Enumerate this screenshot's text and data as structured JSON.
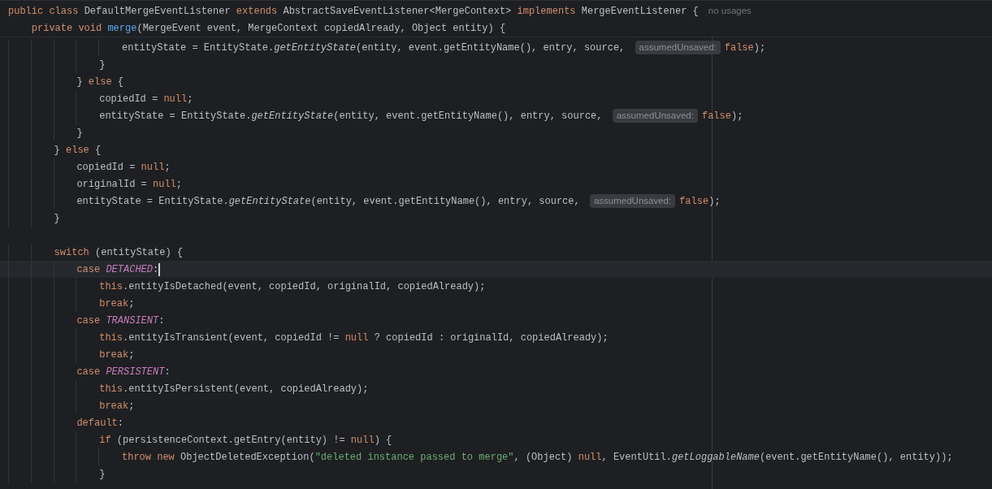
{
  "sticky_lines": [
    {
      "tokens": [
        {
          "kind": "keyword",
          "text": "public class "
        },
        {
          "kind": "plain",
          "text": "DefaultMergeEventListener "
        },
        {
          "kind": "keyword",
          "text": "extends "
        },
        {
          "kind": "plain",
          "text": "AbstractSaveEventListener<MergeContext> "
        },
        {
          "kind": "keyword",
          "text": "implements "
        },
        {
          "kind": "plain",
          "text": "MergeEventListener {"
        },
        {
          "kind": "usages",
          "text": "no usages"
        }
      ]
    },
    {
      "tokens": [
        {
          "kind": "keyword",
          "text": "    private void "
        },
        {
          "kind": "declaration",
          "text": "merge"
        },
        {
          "kind": "plain",
          "text": "(MergeEvent event, MergeContext copiedAlready, Object entity) {"
        }
      ]
    }
  ],
  "lines": [
    {
      "current": false,
      "tokens": [
        {
          "kind": "plain",
          "text": "                    entityState = EntityState."
        },
        {
          "kind": "static_call",
          "text": "getEntityState"
        },
        {
          "kind": "plain",
          "text": "(entity, event.getEntityName(), entry, source, "
        },
        {
          "kind": "hint",
          "text": "assumedUnsaved:"
        },
        {
          "kind": "keyword",
          "text": "false"
        },
        {
          "kind": "plain",
          "text": ");"
        }
      ]
    },
    {
      "current": false,
      "tokens": [
        {
          "kind": "plain",
          "text": "                }"
        }
      ]
    },
    {
      "current": false,
      "tokens": [
        {
          "kind": "plain",
          "text": "            } "
        },
        {
          "kind": "keyword",
          "text": "else"
        },
        {
          "kind": "plain",
          "text": " {"
        }
      ]
    },
    {
      "current": false,
      "tokens": [
        {
          "kind": "plain",
          "text": "                copiedId = "
        },
        {
          "kind": "keyword",
          "text": "null"
        },
        {
          "kind": "plain",
          "text": ";"
        }
      ]
    },
    {
      "current": false,
      "tokens": [
        {
          "kind": "plain",
          "text": "                entityState = EntityState."
        },
        {
          "kind": "static_call",
          "text": "getEntityState"
        },
        {
          "kind": "plain",
          "text": "(entity, event.getEntityName(), entry, source, "
        },
        {
          "kind": "hint",
          "text": "assumedUnsaved:"
        },
        {
          "kind": "keyword",
          "text": "false"
        },
        {
          "kind": "plain",
          "text": ");"
        }
      ]
    },
    {
      "current": false,
      "tokens": [
        {
          "kind": "plain",
          "text": "            }"
        }
      ]
    },
    {
      "current": false,
      "tokens": [
        {
          "kind": "plain",
          "text": "        } "
        },
        {
          "kind": "keyword",
          "text": "else"
        },
        {
          "kind": "plain",
          "text": " {"
        }
      ]
    },
    {
      "current": false,
      "tokens": [
        {
          "kind": "plain",
          "text": "            copiedId = "
        },
        {
          "kind": "keyword",
          "text": "null"
        },
        {
          "kind": "plain",
          "text": ";"
        }
      ]
    },
    {
      "current": false,
      "tokens": [
        {
          "kind": "plain",
          "text": "            originalId = "
        },
        {
          "kind": "keyword",
          "text": "null"
        },
        {
          "kind": "plain",
          "text": ";"
        }
      ]
    },
    {
      "current": false,
      "tokens": [
        {
          "kind": "plain",
          "text": "            entityState = EntityState."
        },
        {
          "kind": "static_call",
          "text": "getEntityState"
        },
        {
          "kind": "plain",
          "text": "(entity, event.getEntityName(), entry, source, "
        },
        {
          "kind": "hint",
          "text": "assumedUnsaved:"
        },
        {
          "kind": "keyword",
          "text": "false"
        },
        {
          "kind": "plain",
          "text": ");"
        }
      ]
    },
    {
      "current": false,
      "tokens": [
        {
          "kind": "plain",
          "text": "        }"
        }
      ]
    },
    {
      "current": false
    },
    {
      "current": false,
      "tokens": [
        {
          "kind": "keyword",
          "text": "        switch"
        },
        {
          "kind": "plain",
          "text": " (entityState) {"
        }
      ]
    },
    {
      "current": true,
      "tokens": [
        {
          "kind": "keyword",
          "text": "            case "
        },
        {
          "kind": "constant",
          "text": "DETACHED"
        },
        {
          "kind": "plain",
          "text": ":"
        }
      ]
    },
    {
      "current": false,
      "tokens": [
        {
          "kind": "keyword",
          "text": "                this"
        },
        {
          "kind": "plain",
          "text": ".entityIsDetached(event, copiedId, originalId, copiedAlready);"
        }
      ]
    },
    {
      "current": false,
      "tokens": [
        {
          "kind": "keyword",
          "text": "                break"
        },
        {
          "kind": "plain",
          "text": ";"
        }
      ]
    },
    {
      "current": false,
      "tokens": [
        {
          "kind": "keyword",
          "text": "            case "
        },
        {
          "kind": "constant",
          "text": "TRANSIENT"
        },
        {
          "kind": "plain",
          "text": ":"
        }
      ]
    },
    {
      "current": false,
      "tokens": [
        {
          "kind": "keyword",
          "text": "                this"
        },
        {
          "kind": "plain",
          "text": ".entityIsTransient(event, copiedId != "
        },
        {
          "kind": "keyword",
          "text": "null"
        },
        {
          "kind": "plain",
          "text": " ? copiedId : originalId, copiedAlready);"
        }
      ]
    },
    {
      "current": false,
      "tokens": [
        {
          "kind": "keyword",
          "text": "                break"
        },
        {
          "kind": "plain",
          "text": ";"
        }
      ]
    },
    {
      "current": false,
      "tokens": [
        {
          "kind": "keyword",
          "text": "            case "
        },
        {
          "kind": "constant",
          "text": "PERSISTENT"
        },
        {
          "kind": "plain",
          "text": ":"
        }
      ]
    },
    {
      "current": false,
      "tokens": [
        {
          "kind": "keyword",
          "text": "                this"
        },
        {
          "kind": "plain",
          "text": ".entityIsPersistent(event, copiedAlready);"
        }
      ]
    },
    {
      "current": false,
      "tokens": [
        {
          "kind": "keyword",
          "text": "                break"
        },
        {
          "kind": "plain",
          "text": ";"
        }
      ]
    },
    {
      "current": false,
      "tokens": [
        {
          "kind": "keyword",
          "text": "            default"
        },
        {
          "kind": "plain",
          "text": ":"
        }
      ]
    },
    {
      "current": false,
      "tokens": [
        {
          "kind": "keyword",
          "text": "                if"
        },
        {
          "kind": "plain",
          "text": " (persistenceContext.getEntry(entity) != "
        },
        {
          "kind": "keyword",
          "text": "null"
        },
        {
          "kind": "plain",
          "text": ") {"
        }
      ]
    },
    {
      "current": false,
      "tokens": [
        {
          "kind": "keyword",
          "text": "                    throw new "
        },
        {
          "kind": "plain",
          "text": "ObjectDeletedException("
        },
        {
          "kind": "string",
          "text": "\"deleted instance passed to merge\""
        },
        {
          "kind": "plain",
          "text": ", (Object) "
        },
        {
          "kind": "keyword",
          "text": "null"
        },
        {
          "kind": "plain",
          "text": ", EventUtil."
        },
        {
          "kind": "static_call",
          "text": "getLoggableName"
        },
        {
          "kind": "plain",
          "text": "(event.getEntityName(), entity));"
        }
      ]
    },
    {
      "current": false,
      "tokens": [
        {
          "kind": "plain",
          "text": "                }"
        }
      ]
    }
  ]
}
